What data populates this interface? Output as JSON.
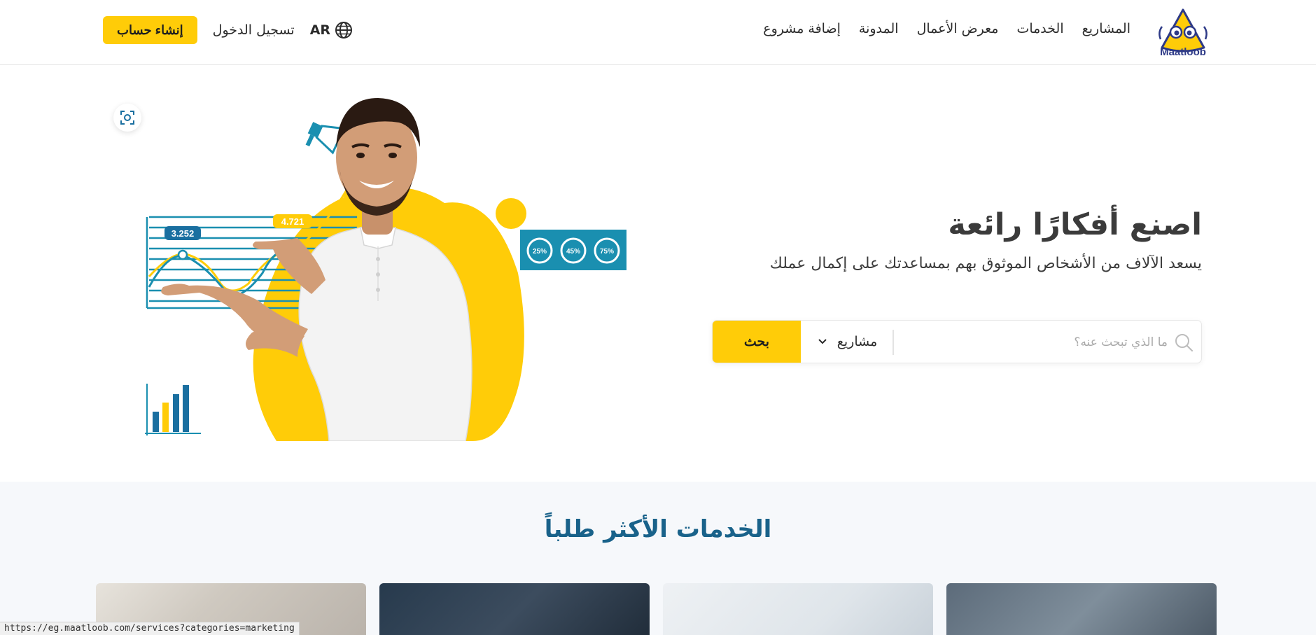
{
  "nav": {
    "logo_text": "Maatloob",
    "links": [
      "المشاريع",
      "الخدمات",
      "معرض الأعمال",
      "المدونة",
      "إضافة مشروع"
    ],
    "language": "AR",
    "login": "تسجيل الدخول",
    "signup": "إنشاء حساب"
  },
  "hero": {
    "title": "اصنع أفكارًا رائعة",
    "subtitle": "يسعد الآلاف من الأشخاص الموثوق بهم بمساعدتك على إكمال عملك",
    "search_placeholder": "ما الذي تبحث عنه؟",
    "select_value": "مشاريع",
    "search_button": "بحث",
    "art": {
      "stat_a": "3.252",
      "stat_b": "4.721",
      "progress": [
        "25%",
        "45%",
        "75%"
      ]
    }
  },
  "services": {
    "title": "الخدمات الأكثر طلباً"
  },
  "status_bar": {
    "url": "https://eg.maatloob.com/services?categories=marketing"
  },
  "colors": {
    "accent": "#ffcc08",
    "heading_blue": "#19628a",
    "chart_teal": "#1a8fb0",
    "logo_blue": "#2e3a87"
  }
}
